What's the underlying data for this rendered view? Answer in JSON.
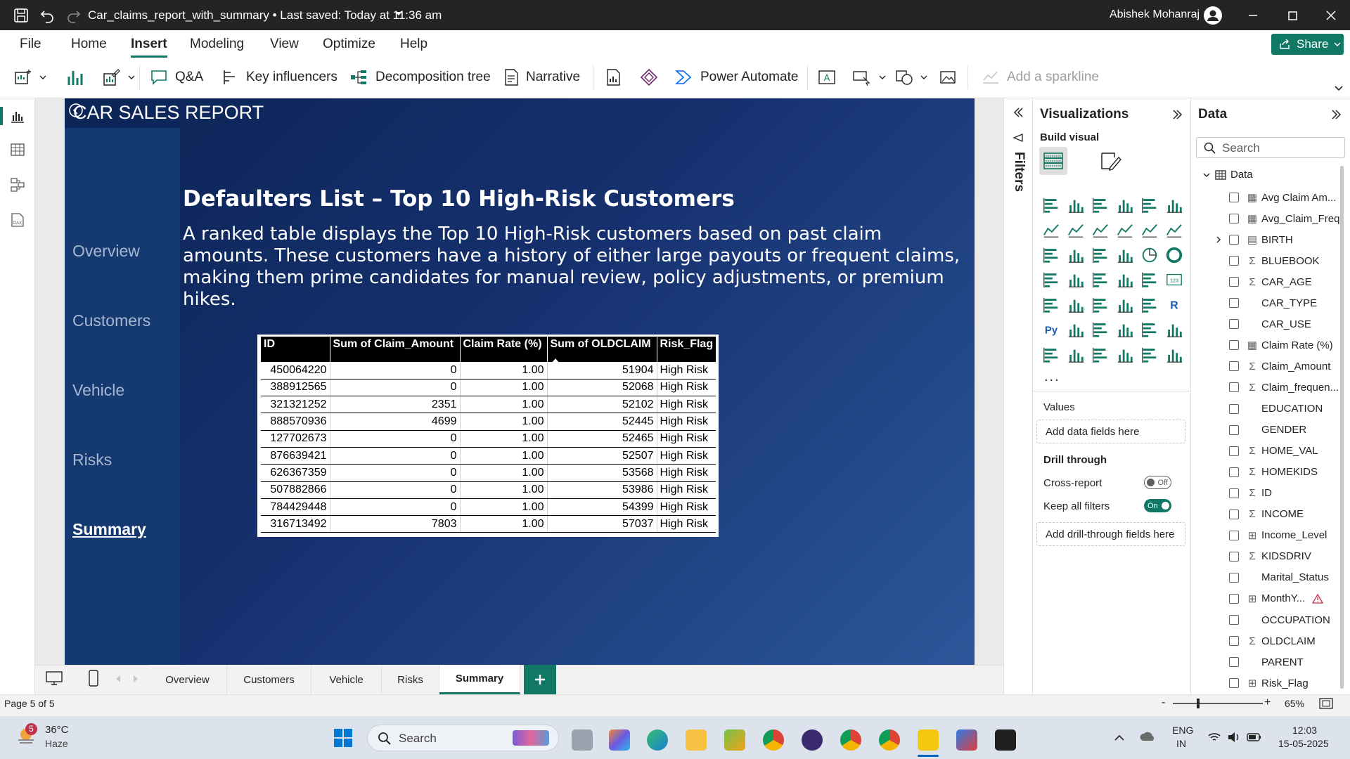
{
  "titlebar": {
    "doc_title": "Car_claims_report_with_summary • Last saved: Today at 11:36 am",
    "user": "Abishek Mohanraj"
  },
  "menu": [
    "File",
    "Home",
    "Insert",
    "Modeling",
    "View",
    "Optimize",
    "Help"
  ],
  "menu_active": "Insert",
  "share_label": "Share",
  "ribbon": {
    "qa": "Q&A",
    "key_influencers": "Key influencers",
    "decomposition_tree": "Decomposition tree",
    "narrative": "Narrative",
    "power_automate": "Power Automate",
    "add_sparkline": "Add a sparkline"
  },
  "report": {
    "title": "CAR SALES REPORT",
    "nav_pages": [
      "Overview",
      "Customers",
      "Vehicle",
      "Risks",
      "Summary"
    ],
    "active_page": "Summary",
    "heading": "Defaulters List – Top 10 High-Risk Customers",
    "description": "A ranked table displays the Top 10 High-Risk customers based on past claim amounts. These customers have a history of either large payouts or frequent claims, making them prime candidates for manual review, policy adjustments, or premium hikes."
  },
  "table": {
    "columns": [
      "ID",
      "Sum of Claim_Amount",
      "Claim Rate (%)",
      "Sum of OLDCLAIM",
      "Risk_Flag"
    ],
    "sorted_column": "Sum of OLDCLAIM",
    "rows": [
      [
        "450064220",
        "0",
        "1.00",
        "51904",
        "High Risk"
      ],
      [
        "388912565",
        "0",
        "1.00",
        "52068",
        "High Risk"
      ],
      [
        "321321252",
        "2351",
        "1.00",
        "52102",
        "High Risk"
      ],
      [
        "888570936",
        "4699",
        "1.00",
        "52445",
        "High Risk"
      ],
      [
        "127702673",
        "0",
        "1.00",
        "52465",
        "High Risk"
      ],
      [
        "876639421",
        "0",
        "1.00",
        "52507",
        "High Risk"
      ],
      [
        "626367359",
        "0",
        "1.00",
        "53568",
        "High Risk"
      ],
      [
        "507882866",
        "0",
        "1.00",
        "53986",
        "High Risk"
      ],
      [
        "784429448",
        "0",
        "1.00",
        "54399",
        "High Risk"
      ],
      [
        "316713492",
        "7803",
        "1.00",
        "57037",
        "High Risk"
      ]
    ]
  },
  "filters_label": "Filters",
  "viz_pane": {
    "title": "Visualizations",
    "build_visual": "Build visual",
    "values_label": "Values",
    "values_placeholder": "Add data fields here",
    "drill_through": "Drill through",
    "cross_report": "Cross-report",
    "cross_report_state": "Off",
    "keep_all_filters": "Keep all filters",
    "keep_filters_state": "On",
    "drill_placeholder": "Add drill-through fields here",
    "more": "..."
  },
  "data_pane": {
    "title": "Data",
    "search_placeholder": "Search",
    "table_name": "Data",
    "fields": [
      {
        "name": "Avg Claim Am...",
        "type": "calc-icon"
      },
      {
        "name": "Avg_Claim_Freq",
        "type": "calc-icon"
      },
      {
        "name": "BIRTH",
        "type": "calendar-icon",
        "expandable": true
      },
      {
        "name": "BLUEBOOK",
        "type": "sigma-icon"
      },
      {
        "name": "CAR_AGE",
        "type": "sigma-icon"
      },
      {
        "name": "CAR_TYPE",
        "type": ""
      },
      {
        "name": "CAR_USE",
        "type": ""
      },
      {
        "name": "Claim Rate (%)",
        "type": "calc-icon"
      },
      {
        "name": "Claim_Amount",
        "type": "sigma-icon"
      },
      {
        "name": "Claim_frequen...",
        "type": "sigma-icon"
      },
      {
        "name": "EDUCATION",
        "type": ""
      },
      {
        "name": "GENDER",
        "type": ""
      },
      {
        "name": "HOME_VAL",
        "type": "sigma-icon"
      },
      {
        "name": "HOMEKIDS",
        "type": "sigma-icon"
      },
      {
        "name": "ID",
        "type": "sigma-icon"
      },
      {
        "name": "INCOME",
        "type": "sigma-icon"
      },
      {
        "name": "Income_Level",
        "type": "calc-column-icon"
      },
      {
        "name": "KIDSDRIV",
        "type": "sigma-icon"
      },
      {
        "name": "Marital_Status",
        "type": ""
      },
      {
        "name": "MonthY...",
        "type": "calc-column-icon",
        "warning": true
      },
      {
        "name": "OCCUPATION",
        "type": ""
      },
      {
        "name": "OLDCLAIM",
        "type": "sigma-icon"
      },
      {
        "name": "PARENT",
        "type": ""
      },
      {
        "name": "Risk_Flag",
        "type": "calc-column-icon"
      }
    ]
  },
  "page_tabs": [
    "Overview",
    "Customers",
    "Vehicle",
    "Risks",
    "Summary"
  ],
  "status": {
    "page": "Page 5 of 5",
    "zoom": "65%"
  },
  "taskbar": {
    "weather_temp": "36°C",
    "weather_desc": "Haze",
    "weather_badge": "5",
    "search": "Search",
    "lang1": "ENG",
    "lang2": "IN",
    "time": "12:03",
    "date": "15-05-2025"
  },
  "colors": {
    "accent": "#117865",
    "report_bg": "#16306e",
    "report_sidebar": "#153a72",
    "titlebar": "#252423"
  }
}
